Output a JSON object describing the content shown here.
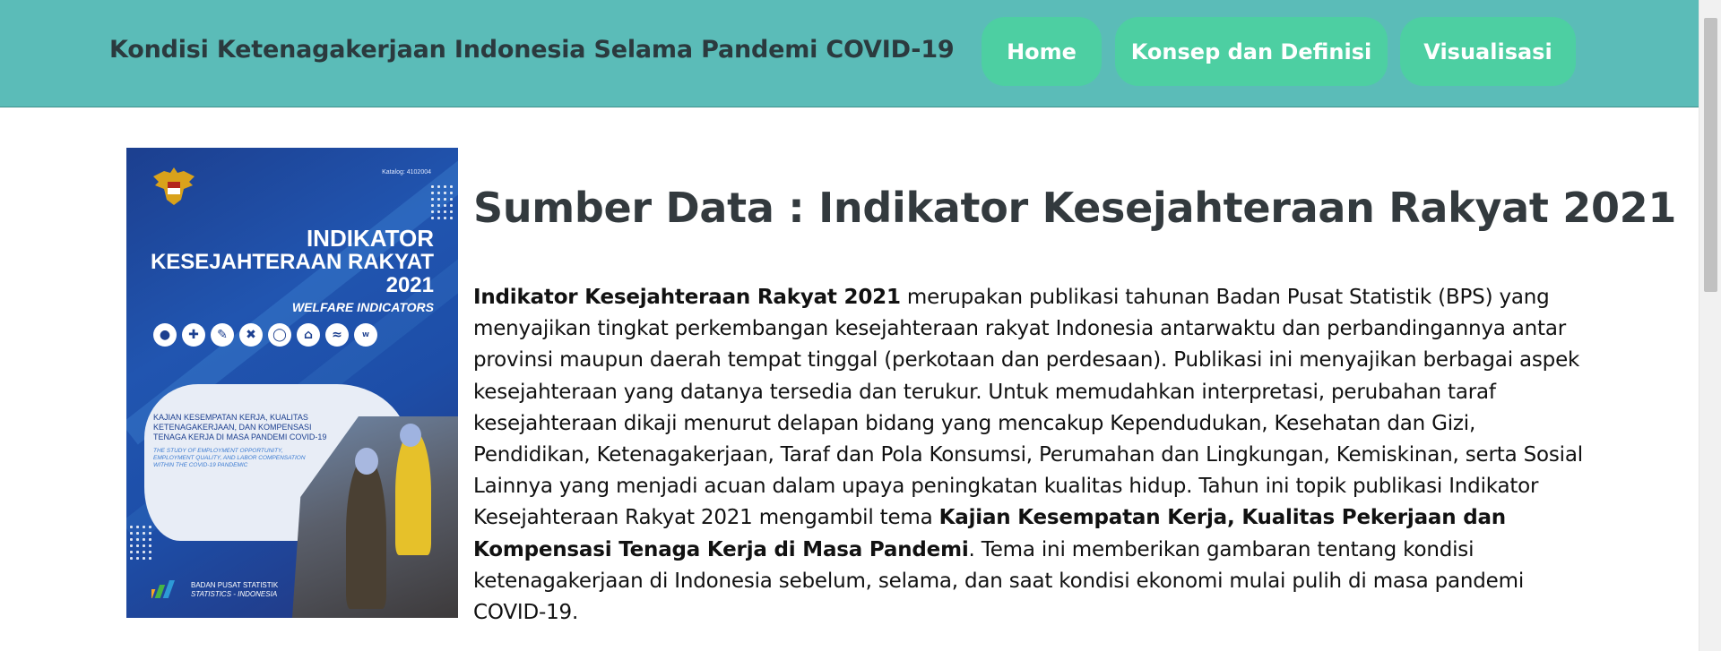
{
  "navbar": {
    "brand": "Kondisi Ketenagakerjaan Indonesia Selama Pandemi COVID-19",
    "items": [
      {
        "label": "Home"
      },
      {
        "label": "Konsep dan Definisi"
      },
      {
        "label": "Visualisasi"
      }
    ],
    "colors": {
      "bar": "#5bbcb8",
      "button": "#4dcfa2"
    }
  },
  "cover": {
    "catalog": "Katalog: 4102004",
    "title_line1": "INDIKATOR",
    "title_line2": "KESEJAHTERAAN RAKYAT",
    "year": "2021",
    "subtitle": "WELFARE INDICATORS",
    "theme_id": "KAJIAN KESEMPATAN KERJA, KUALITAS KETENAGAKERJAAN, DAN KOMPENSASI TENAGA KERJA DI MASA PANDEMI COVID-19",
    "theme_en": "THE STUDY OF EMPLOYMENT OPPORTUNITY, EMPLOYMENT QUALITY, AND LABOR COMPENSATION WITHIN THE COVID-19 PANDEMIC",
    "publisher_line1": "BADAN PUSAT STATISTIK",
    "publisher_line2": "STATISTICS - INDONESIA",
    "icons": [
      "people-icon",
      "health-cross-icon",
      "education-icon",
      "tools-icon",
      "food-icon",
      "house-icon",
      "boat-icon",
      "www-icon"
    ]
  },
  "main": {
    "title": "Sumber Data : Indikator Kesejahteraan Rakyat 2021",
    "para_bold_1": "Indikator Kesejahteraan Rakyat 2021",
    "para_text_1": " merupakan publikasi tahunan Badan Pusat Statistik (BPS) yang menyajikan tingkat perkembangan kesejahteraan rakyat Indonesia antarwaktu dan perbandingannya antar provinsi maupun daerah tempat tinggal (perkotaan dan perdesaan). Publikasi ini menyajikan berbagai aspek kesejahteraan yang datanya tersedia dan terukur. Untuk memudahkan interpretasi, perubahan taraf kesejahteraan dikaji menurut delapan bidang yang mencakup Kependudukan, Kesehatan dan Gizi, Pendidikan, Ketenagakerjaan, Taraf dan Pola Konsumsi, Perumahan dan Lingkungan, Kemiskinan, serta Sosial Lainnya yang menjadi acuan dalam upaya peningkatan kualitas hidup. Tahun ini topik publikasi Indikator Kesejahteraan Rakyat 2021 mengambil tema ",
    "para_bold_2": "Kajian Kesempatan Kerja, Kualitas Pekerjaan dan Kompensasi Tenaga Kerja di Masa Pandemi",
    "para_text_2": ". Tema ini memberikan gambaran tentang kondisi ketenagakerjaan di Indonesia sebelum, selama, dan saat kondisi ekonomi mulai pulih di masa pandemi COVID-19."
  }
}
